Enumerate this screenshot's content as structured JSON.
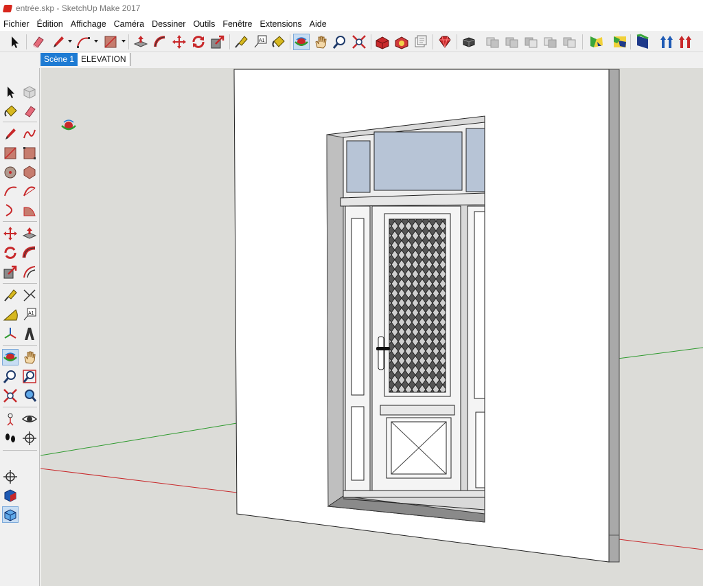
{
  "window": {
    "title": "entrée.skp - SketchUp Make 2017"
  },
  "menu": [
    "Fichier",
    "Édition",
    "Affichage",
    "Caméra",
    "Dessiner",
    "Outils",
    "Fenêtre",
    "Extensions",
    "Aide"
  ],
  "scenes": [
    {
      "label": "Scène 1",
      "active": true
    },
    {
      "label": "ELEVATION",
      "active": false
    }
  ],
  "toolbar": {
    "text_tool_glyph": "A1",
    "groups": [
      [
        "select-icon"
      ],
      [
        "eraser-icon",
        "pencil-icon",
        "arc-icon",
        "rectangle-icon"
      ],
      [
        "push-pull-icon",
        "follow-me-icon",
        "move-icon",
        "rotate-icon",
        "scale-icon"
      ],
      [
        "tape-measure-icon",
        "text-icon",
        "paint-bucket-icon"
      ],
      [
        "orbit-icon",
        "pan-icon",
        "zoom-icon",
        "zoom-extents-icon"
      ],
      [
        "3d-warehouse-icon",
        "extension-warehouse-icon",
        "layout-icon"
      ],
      [
        "ruby-icon"
      ],
      [
        "outer-shell-icon",
        "intersect-icon",
        "union-icon",
        "subtract-icon",
        "trim-icon",
        "split-icon"
      ],
      [
        "sandbox-icon",
        "drape-icon"
      ],
      [
        "section-plane-icon",
        "push-up-icon",
        "pull-down-icon"
      ]
    ]
  },
  "left_toolbar": {
    "rows": [
      [
        "select-icon",
        "make-component-icon"
      ],
      [
        "paint-bucket-icon",
        "eraser-icon"
      ],
      [
        "pencil-icon",
        "freehand-icon"
      ],
      [
        "rectangle-icon",
        "rotated-rectangle-icon"
      ],
      [
        "circle-icon",
        "polygon-icon"
      ],
      [
        "arc-icon",
        "two-point-arc-icon"
      ],
      [
        "three-point-arc-icon",
        "pie-icon"
      ],
      [
        "move-icon",
        "push-pull-icon"
      ],
      [
        "rotate-icon",
        "follow-me-icon"
      ],
      [
        "scale-icon",
        "offset-icon"
      ],
      [
        "tape-measure-icon",
        "dimension-icon"
      ],
      [
        "protractor-icon",
        "text-icon"
      ],
      [
        "axes-icon",
        "3d-text-icon"
      ],
      [
        "orbit-icon",
        "pan-icon"
      ],
      [
        "zoom-icon",
        "zoom-window-icon"
      ],
      [
        "zoom-extents-icon",
        "previous-view-icon"
      ],
      [
        "position-camera-icon",
        "look-around-icon"
      ],
      [
        "walk-icon",
        "section-plane-icon"
      ],
      [
        "add-location-icon"
      ],
      [
        "photo-texture-icon"
      ],
      [
        "terrain-icon"
      ]
    ]
  },
  "colors": {
    "accent": "#1e7bd3",
    "viewport_bg": "#dcdcd8",
    "red_axis": "#c8282a",
    "green_axis": "#2e9a2e",
    "glass": "#b7c4d6"
  }
}
